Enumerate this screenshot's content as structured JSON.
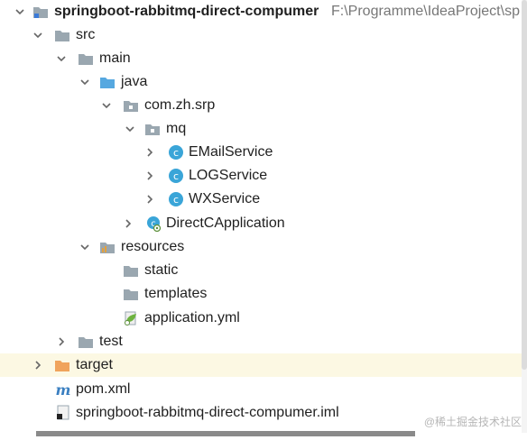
{
  "project": {
    "name": "springboot-rabbitmq-direct-compumer",
    "path": "F:\\Programme\\IdeaProject\\sp"
  },
  "tree": {
    "src": "src",
    "main": "main",
    "java": "java",
    "package": "com.zh.srp",
    "mq": "mq",
    "email_service": "EMailService",
    "log_service": "LOGService",
    "wx_service": "WXService",
    "application_class": "DirectCApplication",
    "resources": "resources",
    "static": "static",
    "templates": "templates",
    "application_yml": "application.yml",
    "test": "test",
    "target": "target",
    "pom": "pom.xml",
    "iml": "springboot-rabbitmq-direct-compumer.iml"
  },
  "watermark": "@稀土掘金技术社区",
  "colors": {
    "selected_row": "#fcf8e3",
    "folder_gray": "#9aa7b0",
    "folder_blue": "#56a8e0",
    "folder_orange": "#f0a35c",
    "class_icon": "#3aa5d8"
  }
}
